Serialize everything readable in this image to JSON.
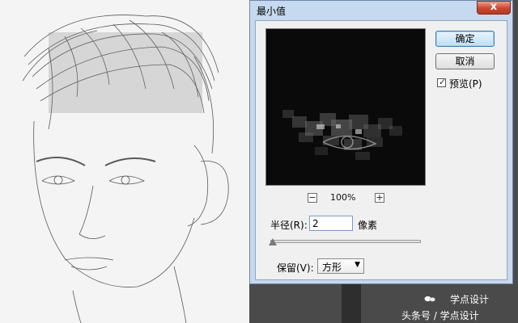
{
  "dialog": {
    "title": "最小值",
    "close_symbol": "x",
    "ok_label": "确定",
    "cancel_label": "取消",
    "preview_checkbox": {
      "label": "预览(P)",
      "checked": true
    },
    "zoom": {
      "minus": "−",
      "plus": "+",
      "level": "100%"
    },
    "radius": {
      "label": "半径(R):",
      "value": "2",
      "unit": "像素",
      "slider_fraction": 0.0
    },
    "preserve": {
      "label": "保留(V):",
      "selected": "方形"
    }
  },
  "watermark": {
    "name": "学点设计",
    "line": "头条号 / 学点设计"
  },
  "colors": {
    "dialog_frame": "#c6d9ee",
    "dialog_client": "#f0f0f0",
    "close_button": "#c9472f",
    "workspace": "#4a4a4a",
    "sketch_bg": "#f4f4f4"
  }
}
